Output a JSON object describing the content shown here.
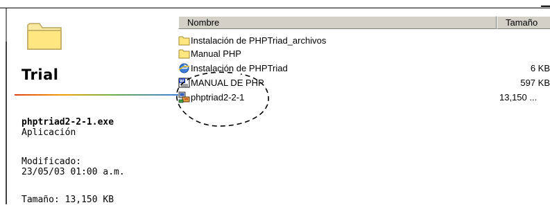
{
  "window": {
    "sidebar": {
      "title": "Trial",
      "file_name": "phptriad2-2-1.exe",
      "file_type": "Aplicación",
      "modified_label": "Modificado:",
      "modified_value": "23/05/03 01:00 a.m.",
      "size_text": "Tamaño: 13,150 KB"
    },
    "columns": {
      "name": "Nombre",
      "size": "Tamaño"
    },
    "files": [
      {
        "name": "Instalación de PHPTriad_archivos",
        "size": "",
        "icon": "folder-icon"
      },
      {
        "name": "Manual PHP",
        "size": "",
        "icon": "folder-icon"
      },
      {
        "name": "Instalación de PHPTriad",
        "size": "6 KB",
        "icon": "internet-explorer-document-icon"
      },
      {
        "name": "MANUAL DE PHP",
        "size": "597 KB",
        "icon": "word-document-icon"
      },
      {
        "name": "phptriad2-2-1",
        "size": "13,150 ...",
        "icon": "installer-application-icon"
      }
    ],
    "colors": {
      "header_bg": "#d4d0c8",
      "folder_yellow": "#ffe680",
      "gradient": [
        "#e04010",
        "#f0a000",
        "#6cb04a",
        "#3d7fd8"
      ]
    }
  }
}
